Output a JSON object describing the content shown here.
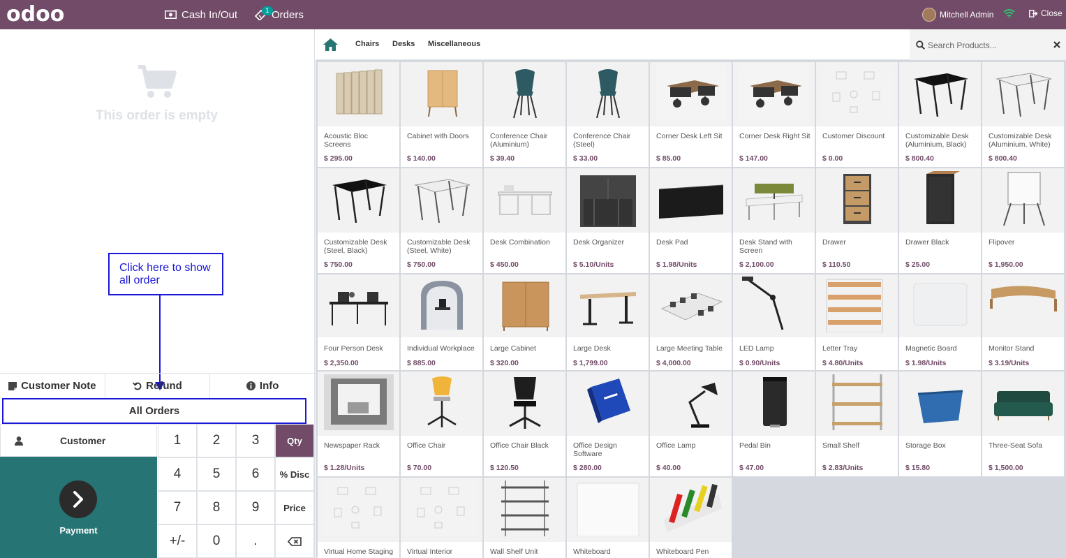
{
  "topbar": {
    "logo": "odoo",
    "cash_label": "Cash In/Out",
    "orders_label": "Orders",
    "orders_badge": "1",
    "user_name": "Mitchell Admin",
    "close_label": "Close"
  },
  "order": {
    "empty_text": "This order is empty"
  },
  "annotation": {
    "text": "Click here to show all order"
  },
  "controls": {
    "customer_note": "Customer Note",
    "refund": "Refund",
    "info": "Info",
    "all_orders": "All Orders",
    "customer": "Customer",
    "payment": "Payment"
  },
  "numpad": {
    "keys": [
      "1",
      "2",
      "3",
      "Qty",
      "4",
      "5",
      "6",
      "% Disc",
      "7",
      "8",
      "9",
      "Price",
      "+/-",
      "0",
      "."
    ],
    "active_mode": "Qty"
  },
  "categories": {
    "items": [
      "Chairs",
      "Desks",
      "Miscellaneous"
    ]
  },
  "search": {
    "placeholder": "Search Products..."
  },
  "products": [
    {
      "name": "Acoustic Bloc Screens",
      "price": "$ 295.00",
      "icon": "acoustic-screen"
    },
    {
      "name": "Cabinet with Doors",
      "price": "$ 140.00",
      "icon": "cabinet"
    },
    {
      "name": "Conference Chair (Aluminium)",
      "price": "$ 39.40",
      "icon": "chair"
    },
    {
      "name": "Conference Chair (Steel)",
      "price": "$ 33.00",
      "icon": "chair"
    },
    {
      "name": "Corner Desk Left Sit",
      "price": "$ 85.00",
      "icon": "desk-set"
    },
    {
      "name": "Corner Desk Right Sit",
      "price": "$ 147.00",
      "icon": "desk-set"
    },
    {
      "name": "Customer Discount",
      "price": "$ 0.00",
      "icon": "placeholder"
    },
    {
      "name": "Customizable Desk (Aluminium, Black)",
      "price": "$ 800.40",
      "icon": "desk-black"
    },
    {
      "name": "Customizable Desk (Aluminium, White)",
      "price": "$ 800.40",
      "icon": "desk-white"
    },
    {
      "name": "Customizable Desk (Steel, Black)",
      "price": "$ 750.00",
      "icon": "desk-black"
    },
    {
      "name": "Customizable Desk (Steel, White)",
      "price": "$ 750.00",
      "icon": "desk-white"
    },
    {
      "name": "Desk Combination",
      "price": "$ 450.00",
      "icon": "desk-combo"
    },
    {
      "name": "Desk Organizer",
      "price": "$ 5.10/Units",
      "icon": "organizer"
    },
    {
      "name": "Desk Pad",
      "price": "$ 1.98/Units",
      "icon": "deskpad"
    },
    {
      "name": "Desk Stand with Screen",
      "price": "$ 2,100.00",
      "icon": "desk-stand"
    },
    {
      "name": "Drawer",
      "price": "$ 110.50",
      "icon": "drawer-wood"
    },
    {
      "name": "Drawer Black",
      "price": "$ 25.00",
      "icon": "drawer-black"
    },
    {
      "name": "Flipover",
      "price": "$ 1,950.00",
      "icon": "flipover"
    },
    {
      "name": "Four Person Desk",
      "price": "$ 2,350.00",
      "icon": "four-desk"
    },
    {
      "name": "Individual Workplace",
      "price": "$ 885.00",
      "icon": "pod"
    },
    {
      "name": "Large Cabinet",
      "price": "$ 320.00",
      "icon": "large-cabinet"
    },
    {
      "name": "Large Desk",
      "price": "$ 1,799.00",
      "icon": "large-desk"
    },
    {
      "name": "Large Meeting Table",
      "price": "$ 4,000.00",
      "icon": "meeting-table"
    },
    {
      "name": "LED Lamp",
      "price": "$ 0.90/Units",
      "icon": "led-lamp"
    },
    {
      "name": "Letter Tray",
      "price": "$ 4.80/Units",
      "icon": "letter-tray"
    },
    {
      "name": "Magnetic Board",
      "price": "$ 1.98/Units",
      "icon": "board"
    },
    {
      "name": "Monitor Stand",
      "price": "$ 3.19/Units",
      "icon": "monitor-stand"
    },
    {
      "name": "Newspaper Rack",
      "price": "$ 1.28/Units",
      "icon": "newspaper-rack"
    },
    {
      "name": "Office Chair",
      "price": "$ 70.00",
      "icon": "office-chair-yellow"
    },
    {
      "name": "Office Chair Black",
      "price": "$ 120.50",
      "icon": "office-chair-black"
    },
    {
      "name": "Office Design Software",
      "price": "$ 280.00",
      "icon": "software-box"
    },
    {
      "name": "Office Lamp",
      "price": "$ 40.00",
      "icon": "office-lamp"
    },
    {
      "name": "Pedal Bin",
      "price": "$ 47.00",
      "icon": "pedal-bin"
    },
    {
      "name": "Small Shelf",
      "price": "$ 2.83/Units",
      "icon": "small-shelf"
    },
    {
      "name": "Storage Box",
      "price": "$ 15.80",
      "icon": "storage-box"
    },
    {
      "name": "Three-Seat Sofa",
      "price": "$ 1,500.00",
      "icon": "sofa"
    },
    {
      "name": "Virtual Home Staging",
      "price": "",
      "icon": "placeholder"
    },
    {
      "name": "Virtual Interior",
      "price": "",
      "icon": "placeholder"
    },
    {
      "name": "Wall Shelf Unit",
      "price": "",
      "icon": "wall-shelf"
    },
    {
      "name": "Whiteboard",
      "price": "",
      "icon": "whiteboard"
    },
    {
      "name": "Whiteboard Pen",
      "price": "",
      "icon": "pens"
    }
  ],
  "colors": {
    "brand": "#714b67",
    "payment": "#277474",
    "annotation": "#1a17d8",
    "accent": "#00a09d"
  }
}
